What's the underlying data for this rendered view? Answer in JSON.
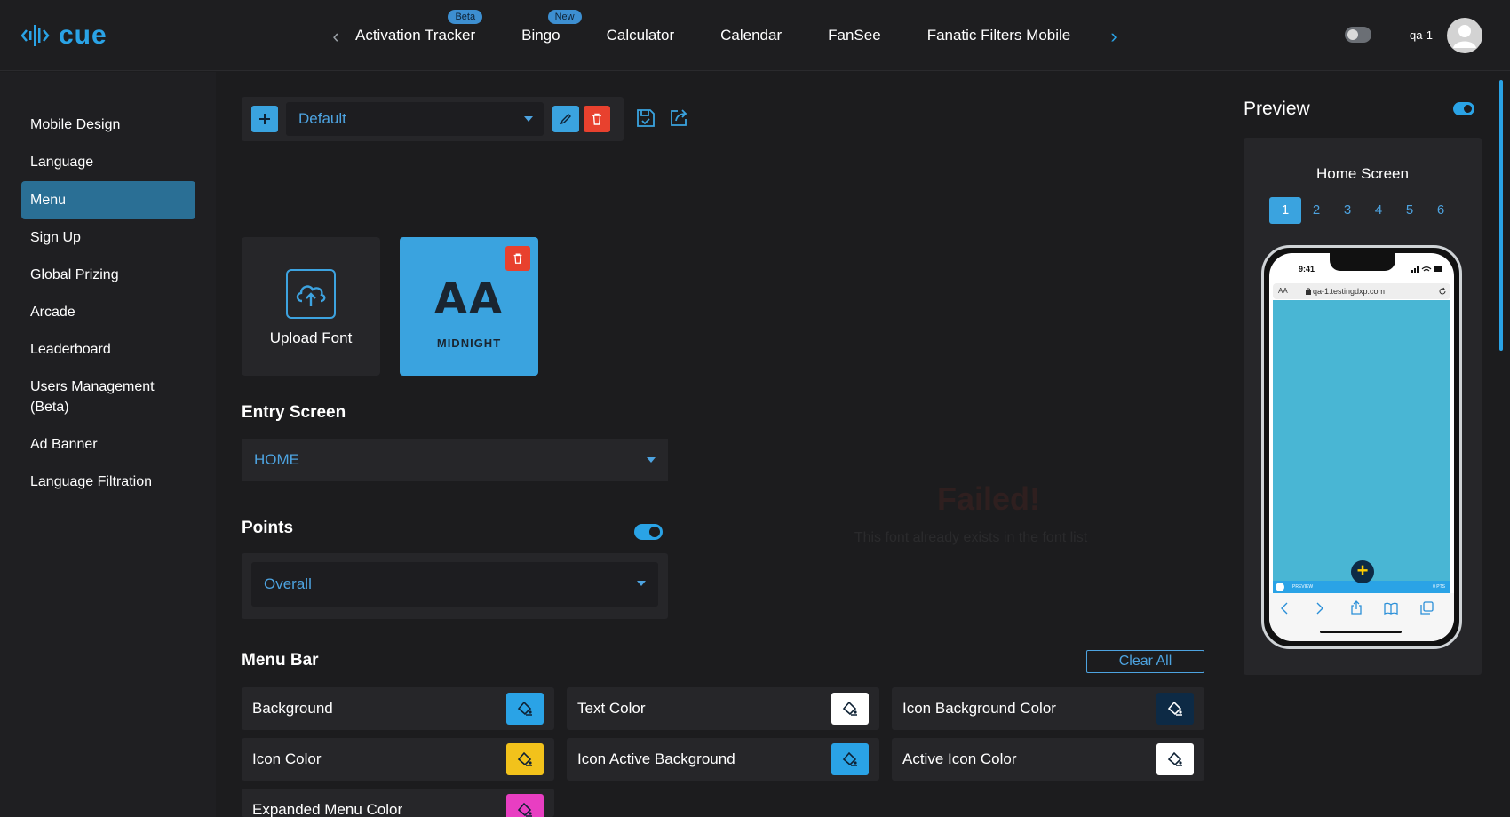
{
  "brand": {
    "name": "cue"
  },
  "app_tabs": [
    {
      "label": "Activation Tracker",
      "badge": "Beta"
    },
    {
      "label": "Bingo",
      "badge": "New"
    },
    {
      "label": "Calculator"
    },
    {
      "label": "Calendar"
    },
    {
      "label": "FanSee"
    },
    {
      "label": "Fanatic Filters Mobile"
    }
  ],
  "user": {
    "name": "qa-1"
  },
  "sidebar": {
    "items": [
      {
        "label": "Mobile Design"
      },
      {
        "label": "Language"
      },
      {
        "label": "Menu",
        "active": true
      },
      {
        "label": "Sign Up"
      },
      {
        "label": "Global Prizing"
      },
      {
        "label": "Arcade"
      },
      {
        "label": "Leaderboard"
      },
      {
        "label": "Users Management (Beta)"
      },
      {
        "label": "Ad Banner"
      },
      {
        "label": "Language Filtration"
      }
    ]
  },
  "toolbar": {
    "theme_select": "Default"
  },
  "fonts": {
    "upload_label": "Upload Font",
    "card_preview": "AA",
    "card_name": "MIDNIGHT"
  },
  "entry_screen": {
    "title": "Entry Screen",
    "value": "HOME"
  },
  "points": {
    "title": "Points",
    "enabled": true,
    "value": "Overall"
  },
  "menu_bar": {
    "title": "Menu Bar",
    "clear_label": "Clear All",
    "colors": [
      {
        "label": "Background",
        "swatch": "#2aa3e6"
      },
      {
        "label": "Text Color",
        "swatch": "#ffffff"
      },
      {
        "label": "Icon Background Color",
        "swatch": "#0d2a45"
      },
      {
        "label": "Icon Color",
        "swatch": "#f2c21b"
      },
      {
        "label": "Icon Active Background",
        "swatch": "#2aa3e6"
      },
      {
        "label": "Active Icon Color",
        "swatch": "#ffffff"
      },
      {
        "label": "Expanded Menu Color",
        "swatch": "#e83ec2"
      }
    ]
  },
  "dialog_ghost": {
    "title": "Failed!",
    "message": "This font already exists in the font list"
  },
  "preview": {
    "title": "Preview",
    "enabled": true,
    "screen_name": "Home Screen",
    "pages": [
      "1",
      "2",
      "3",
      "4",
      "5",
      "6"
    ],
    "active_page": "1",
    "phone": {
      "time": "9:41",
      "url_aa": "AA",
      "url": "qa-1.testingdxp.com",
      "strip_left": "PREVIEW",
      "strip_right": "0 PTS"
    }
  },
  "colors": {
    "accent": "#2aa3e6",
    "danger": "#e8412e",
    "active_side": "#2a6f95"
  }
}
